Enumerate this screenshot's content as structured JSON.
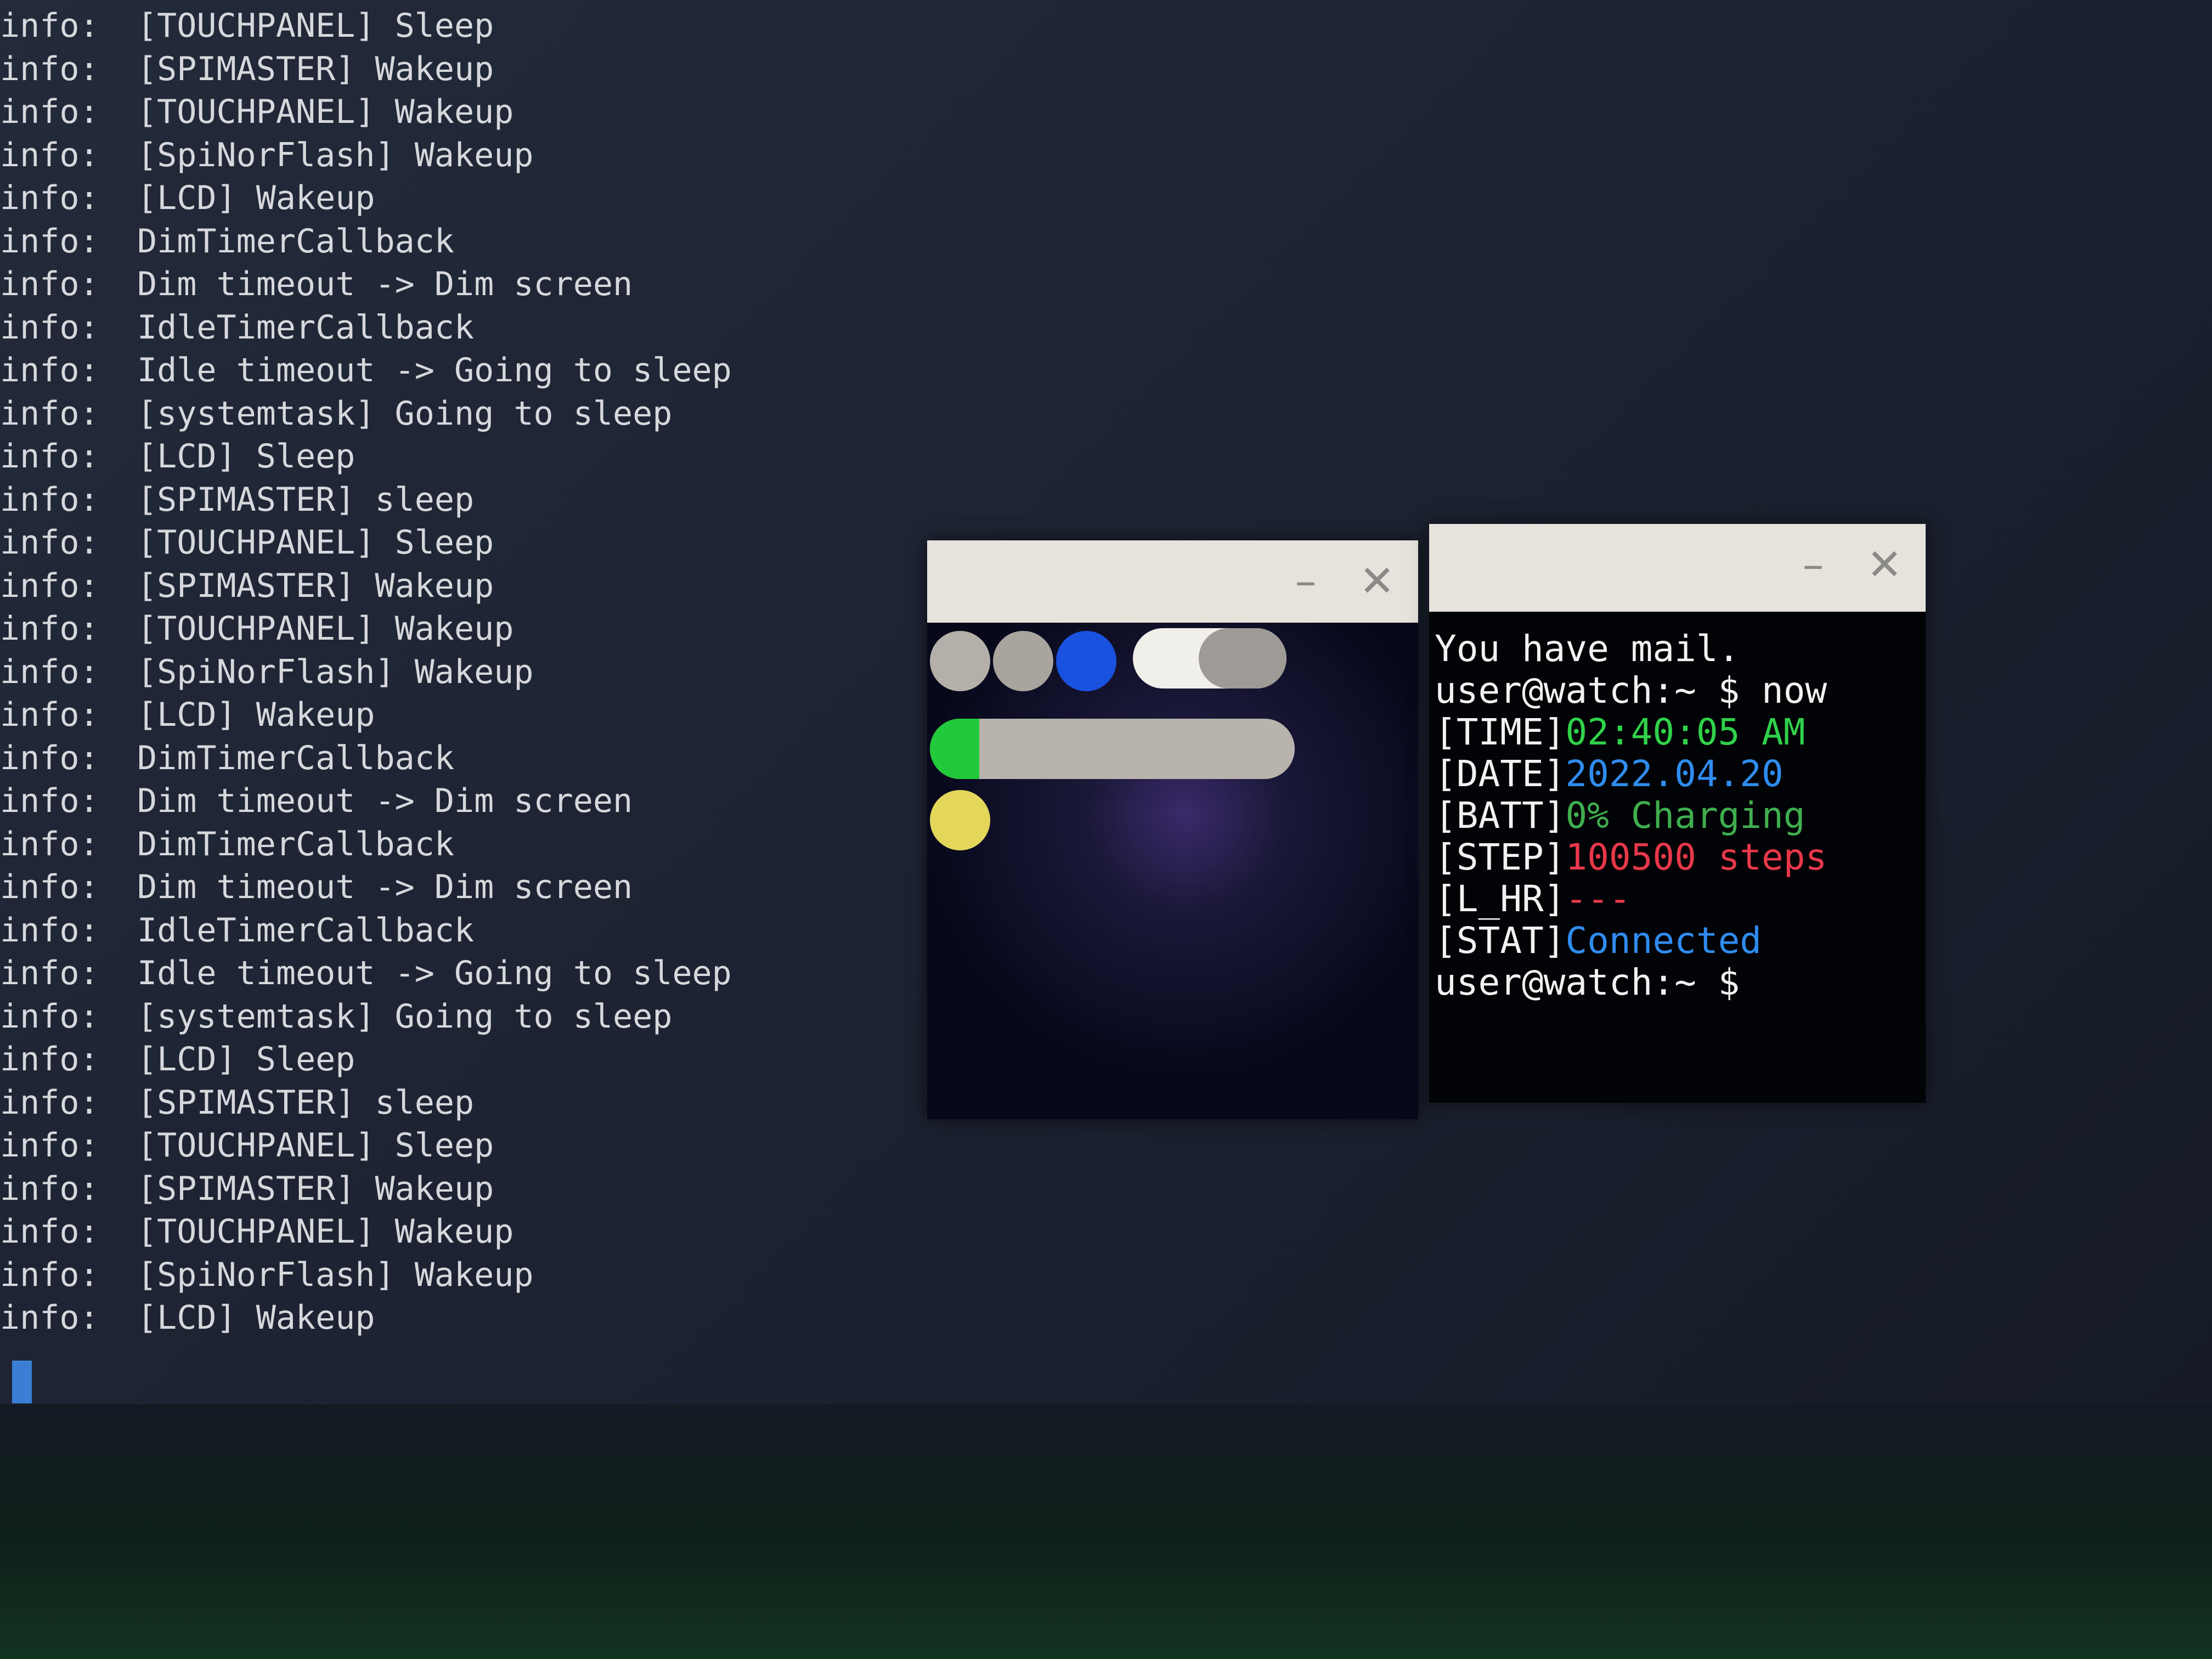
{
  "log": {
    "lines": [
      {
        "level": "info:",
        "msg": "[TOUCHPANEL] Sleep"
      },
      {
        "level": "info:",
        "msg": "[SPIMASTER] Wakeup"
      },
      {
        "level": "info:",
        "msg": "[TOUCHPANEL] Wakeup"
      },
      {
        "level": "info:",
        "msg": "[SpiNorFlash] Wakeup"
      },
      {
        "level": "info:",
        "msg": "[LCD] Wakeup"
      },
      {
        "level": "info:",
        "msg": "DimTimerCallback"
      },
      {
        "level": "info:",
        "msg": "Dim timeout -> Dim screen"
      },
      {
        "level": "info:",
        "msg": "IdleTimerCallback"
      },
      {
        "level": "info:",
        "msg": "Idle timeout -> Going to sleep"
      },
      {
        "level": "info:",
        "msg": "[systemtask] Going to sleep"
      },
      {
        "level": "info:",
        "msg": "[LCD] Sleep"
      },
      {
        "level": "info:",
        "msg": "[SPIMASTER] sleep"
      },
      {
        "level": "info:",
        "msg": "[TOUCHPANEL] Sleep"
      },
      {
        "level": "info:",
        "msg": "[SPIMASTER] Wakeup"
      },
      {
        "level": "info:",
        "msg": "[TOUCHPANEL] Wakeup"
      },
      {
        "level": "info:",
        "msg": "[SpiNorFlash] Wakeup"
      },
      {
        "level": "info:",
        "msg": "[LCD] Wakeup"
      },
      {
        "level": "info:",
        "msg": "DimTimerCallback"
      },
      {
        "level": "info:",
        "msg": "Dim timeout -> Dim screen"
      },
      {
        "level": "info:",
        "msg": "DimTimerCallback"
      },
      {
        "level": "info:",
        "msg": "Dim timeout -> Dim screen"
      },
      {
        "level": "info:",
        "msg": "IdleTimerCallback"
      },
      {
        "level": "info:",
        "msg": "Idle timeout -> Going to sleep"
      },
      {
        "level": "info:",
        "msg": "[systemtask] Going to sleep"
      },
      {
        "level": "info:",
        "msg": "[LCD] Sleep"
      },
      {
        "level": "info:",
        "msg": "[SPIMASTER] sleep"
      },
      {
        "level": "info:",
        "msg": "[TOUCHPANEL] Sleep"
      },
      {
        "level": "info:",
        "msg": "[SPIMASTER] Wakeup"
      },
      {
        "level": "info:",
        "msg": "[TOUCHPANEL] Wakeup"
      },
      {
        "level": "info:",
        "msg": "[SpiNorFlash] Wakeup"
      },
      {
        "level": "info:",
        "msg": "[LCD] Wakeup"
      }
    ]
  },
  "windows": {
    "minimize_glyph": "–",
    "close_glyph": "✕"
  },
  "simulator": {
    "colors": {
      "gray": "#b4afa8",
      "blue": "#1a52e0",
      "white": "#f1efea",
      "green": "#22c93a",
      "yellow": "#e4d65a"
    }
  },
  "terminal": {
    "mail": "You have mail.",
    "prompt": "user@watch:~ $",
    "command": " now",
    "rows": [
      {
        "label": "[TIME]",
        "value": "02:40:05 AM",
        "color": "#2fd24a"
      },
      {
        "label": "[DATE]",
        "value": "2022.04.20",
        "color": "#2f8cf0"
      },
      {
        "label": "[BATT]",
        "value": "0% Charging",
        "color": "#3fae4e"
      },
      {
        "label": "[STEP]",
        "value": "100500 steps",
        "color": "#e8384a"
      },
      {
        "label": "[L_HR]",
        "value": "---",
        "color": "#e8384a"
      },
      {
        "label": "[STAT]",
        "value": "Connected",
        "color": "#2f8cf0"
      }
    ],
    "final_prompt": "user@watch:~ $"
  }
}
